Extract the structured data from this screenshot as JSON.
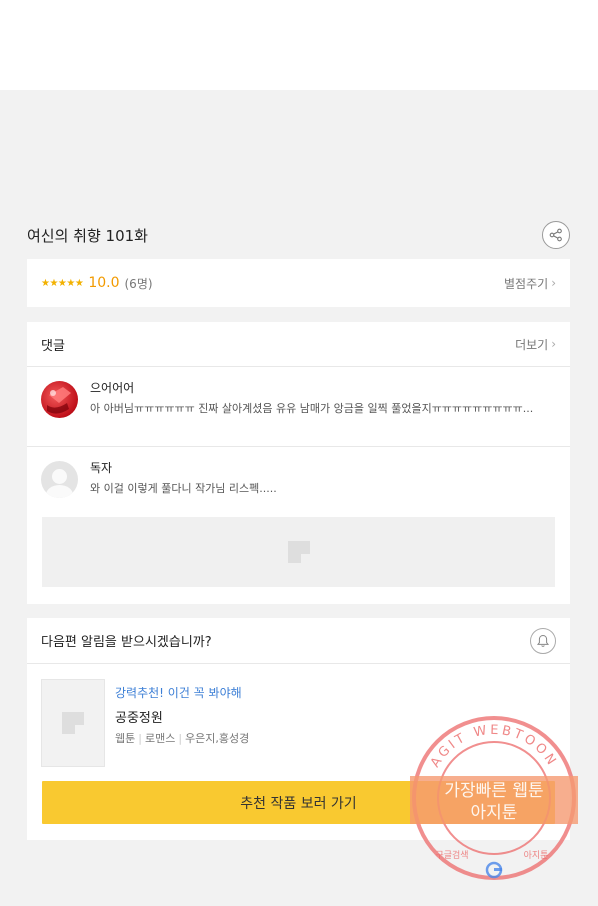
{
  "episode": {
    "title": "여신의 취향 101화"
  },
  "rating": {
    "stars": "★★★★★",
    "score": "10.0",
    "count": "(6명)",
    "rate_link": "별점주기"
  },
  "comments": {
    "header": "댓글",
    "more_link": "더보기",
    "items": [
      {
        "name": "으어어어",
        "text": "아 아버님ㅠㅠㅠㅠㅠㅠ 진짜 살아계셨음 유유 남매가 앙금을 일찍 풀었을지ㅠㅠㅠㅠㅠㅠㅠㅠㅠ..."
      },
      {
        "name": "독자",
        "text": "와 이걸 이렇게 풀다니 작가님 리스펙....."
      }
    ]
  },
  "notify": {
    "question": "다음편 알림을 받으시겠습니까?",
    "recommend": {
      "tag": "강력추천! 이건 꼭 봐야해",
      "title": "공중정원",
      "meta": [
        "웹툰",
        "로맨스",
        "우은지,홍성경"
      ]
    },
    "cta_label": "추천 작품 보러 가기"
  },
  "watermark": {
    "ring_text": "AGIT WEBTOON",
    "line1": "가장빠른 웹툰",
    "line2": "아지툰",
    "bottom_left": "구글검색",
    "bottom_right": "아지툰",
    "color": "#e85050"
  }
}
